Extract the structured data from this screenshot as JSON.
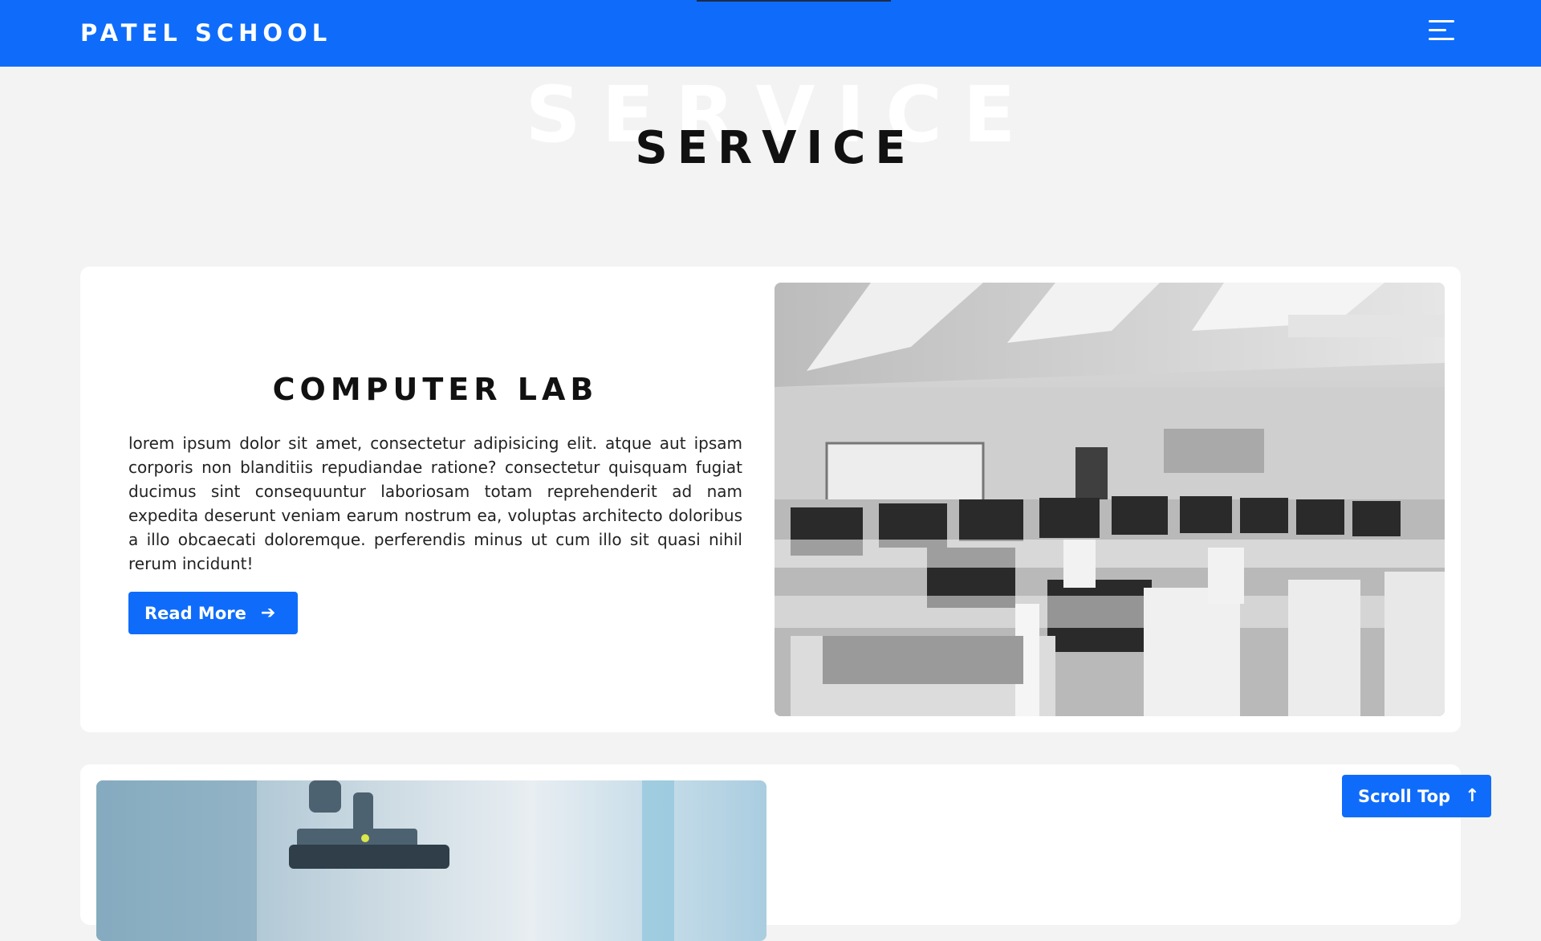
{
  "header": {
    "logo": "PATEL SCHOOL",
    "menu_icon": "hamburger-menu-icon",
    "color": "#0f6cfa"
  },
  "section": {
    "bg_title": "SERVICE",
    "title": "SERVICE"
  },
  "cards": [
    {
      "title": "COMPUTER LAB",
      "description": "lorem ipsum dolor sit amet, consectetur adipisicing elit. atque aut ipsam corporis non blanditiis repudiandae ratione? consectetur quisquam fugiat ducimus sint consequuntur laboriosam totam reprehenderit ad nam expedita deserunt veniam earum nostrum ea, voluptas architecto doloribus a illo obcaecati doloremque. perferendis minus ut cum illo sit quasi nihil rerum incidunt!",
      "button_label": "Read More",
      "button_icon": "arrow-right-icon"
    }
  ],
  "scroll_top": {
    "label": "Scroll Top",
    "icon": "arrow-up-icon"
  }
}
